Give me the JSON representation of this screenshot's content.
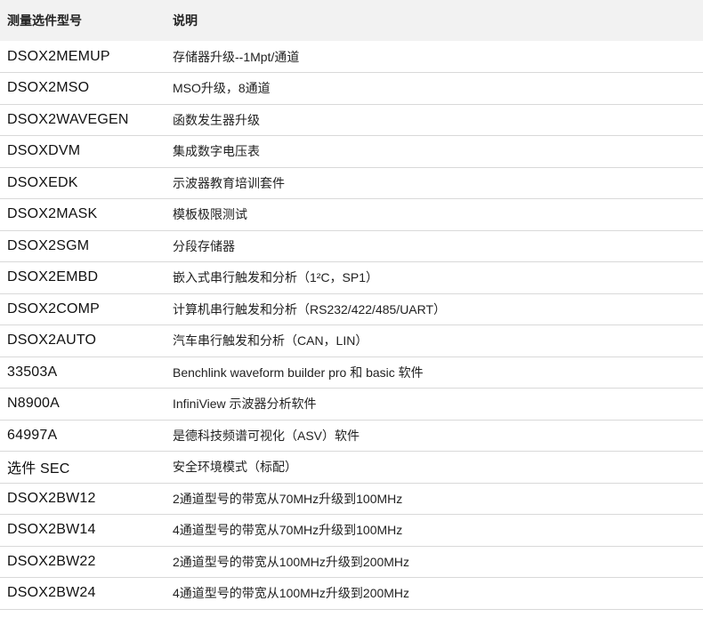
{
  "header": {
    "model": "测量选件型号",
    "description": "说明"
  },
  "rows": [
    {
      "model": "DSOX2MEMUP",
      "description": "存储器升级--1Mpt/通道"
    },
    {
      "model": "DSOX2MSO",
      "description": "MSO升级，8通道"
    },
    {
      "model": "DSOX2WAVEGEN",
      "description": "函数发生器升级"
    },
    {
      "model": "DSOXDVM",
      "description": "集成数字电压表"
    },
    {
      "model": "DSOXEDK",
      "description": "示波器教育培训套件"
    },
    {
      "model": "DSOX2MASK",
      "description": "模板极限测试"
    },
    {
      "model": "DSOX2SGM",
      "description": "分段存储器"
    },
    {
      "model": "DSOX2EMBD",
      "description": "嵌入式串行触发和分析（1²C，SP1）"
    },
    {
      "model": "DSOX2COMP",
      "description": "计算机串行触发和分析（RS232/422/485/UART）"
    },
    {
      "model": "DSOX2AUTO",
      "description": "汽车串行触发和分析（CAN，LIN）"
    },
    {
      "model": "33503A",
      "description": "Benchlink waveform builder pro 和 basic 软件"
    },
    {
      "model": "N8900A",
      "description": "InfiniView 示波器分析软件"
    },
    {
      "model": "64997A",
      "description": "是德科技频谱可视化（ASV）软件"
    },
    {
      "model": "选件 SEC",
      "description": "安全环境模式（标配）"
    },
    {
      "model": "DSOX2BW12",
      "description": "2通道型号的带宽从70MHz升级到100MHz"
    },
    {
      "model": "DSOX2BW14",
      "description": "4通道型号的带宽从70MHz升级到100MHz"
    },
    {
      "model": "DSOX2BW22",
      "description": "2通道型号的带宽从100MHz升级到200MHz"
    },
    {
      "model": "DSOX2BW24",
      "description": "4通道型号的带宽从100MHz升级到200MHz"
    }
  ]
}
